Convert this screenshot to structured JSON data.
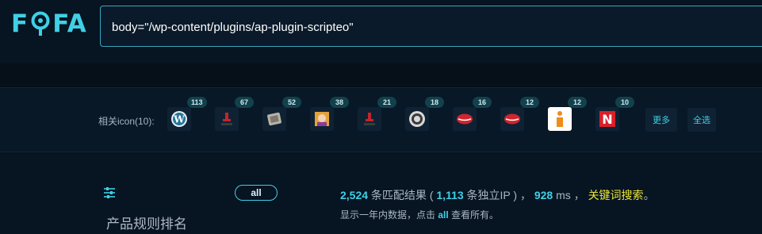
{
  "header": {
    "logo_text": "FOFA",
    "search_value": "body=\"/wp-content/plugins/ap-plugin-scripteo\""
  },
  "icons": {
    "label": "相关icon(10):",
    "items": [
      {
        "name": "wordpress-icon",
        "count": "113"
      },
      {
        "name": "red-figure-icon",
        "count": "67"
      },
      {
        "name": "grey-tile-icon",
        "count": "52"
      },
      {
        "name": "character-icon",
        "count": "38"
      },
      {
        "name": "red-figure-small-icon",
        "count": "21"
      },
      {
        "name": "circle-logo-icon",
        "count": "18"
      },
      {
        "name": "red-lips-icon",
        "count": "16"
      },
      {
        "name": "red-lips-alt-icon",
        "count": "12"
      },
      {
        "name": "orange-info-icon",
        "count": "12"
      },
      {
        "name": "red-n-icon",
        "count": "10"
      }
    ],
    "more_label": "更多",
    "select_all_label": "全选"
  },
  "sidebar": {
    "all_label": "all",
    "rule_title": "产品规则排名"
  },
  "results": {
    "count": "2,524",
    "text_a": " 条匹配结果 ( ",
    "ip_count": "1,113",
    "text_b": " 条独立IP ) ， ",
    "ms": "928",
    "text_c": " ms ， ",
    "keyword_search": "关键词搜索",
    "text_d": "。",
    "sub_a": "显示一年内数据，点击 ",
    "sub_all": "all",
    "sub_b": " 查看所有。"
  },
  "colors": {
    "accent": "#3fd0e6",
    "keyword": "#e9e43a",
    "background": "#071421"
  }
}
